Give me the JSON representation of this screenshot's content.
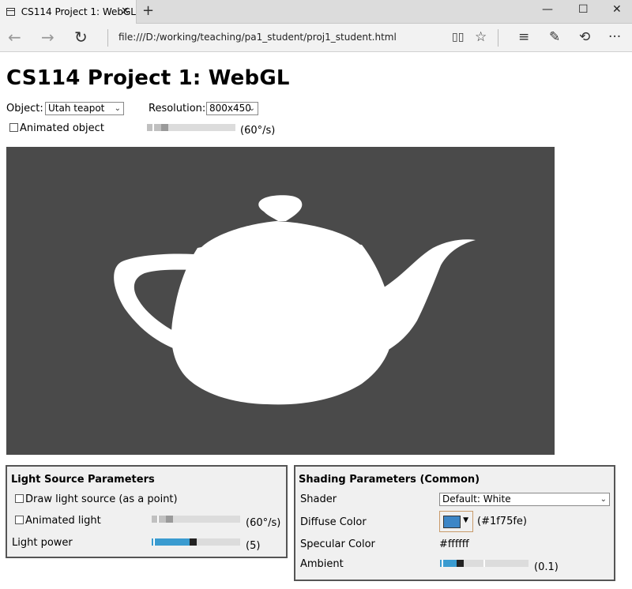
{
  "browser": {
    "tab_title": "CS114 Project 1: WebGL",
    "tab_close": "✕",
    "new_tab": "+",
    "window_controls": {
      "minimize": "—",
      "maximize": "☐",
      "close": "✕"
    },
    "nav": {
      "back": "←",
      "forward": "→",
      "refresh": "↻"
    },
    "address": "file:///D:/working/teaching/pa1_student/proj1_student.html",
    "toolbar_icons": {
      "reading_view": "▯▯",
      "favorite": "☆",
      "hub": "≡",
      "web_note": "✎",
      "share": "⟲",
      "more": "···"
    }
  },
  "page": {
    "title": "CS114 Project 1: WebGL",
    "object_label": "Object:",
    "object_value": "Utah teapot",
    "resolution_label": "Resolution:",
    "resolution_value": "800x450",
    "animated_object_label": "Animated object",
    "animated_object_checked": false,
    "object_speed_text": "(60°/s)",
    "object_speed_fraction": 0.17
  },
  "light_panel": {
    "title": "Light Source Parameters",
    "draw_light_label": "Draw light source (as a point)",
    "draw_light_checked": false,
    "animated_light_label": "Animated light",
    "animated_light_checked": false,
    "light_speed_text": "(60°/s)",
    "light_speed_fraction": 0.17,
    "light_power_label": "Light power",
    "light_power_text": "(5)",
    "light_power_fraction": 0.47
  },
  "shading_panel": {
    "title": "Shading Parameters (Common)",
    "shader_label": "Shader",
    "shader_value": "Default: White",
    "diffuse_label": "Diffuse Color",
    "diffuse_text": "(#1f75fe)",
    "diffuse_color": "#3d86c6",
    "specular_label": "Specular Color",
    "specular_text": "#ffffff",
    "ambient_label": "Ambient",
    "ambient_text": "(0.1)",
    "ambient_fraction": 0.2
  },
  "colors": {
    "canvas_bg": "#4a4a4a",
    "teapot": "#ffffff",
    "slider_blue": "#3a9bd0"
  }
}
